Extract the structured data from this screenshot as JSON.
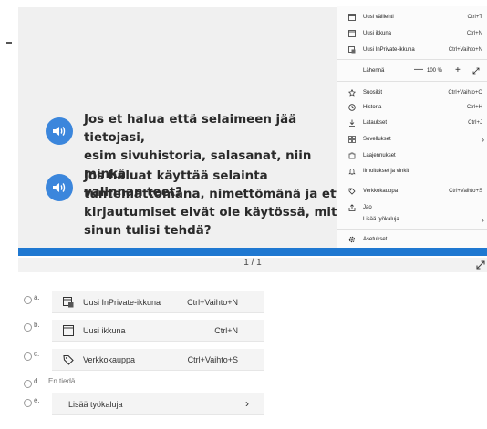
{
  "question": {
    "line1": "Jos et halua että selaimeen jää tietojasi,",
    "line2": "esim sivuhistoria, salasanat, niin minkä",
    "line3": "valinnan teet?",
    "line4": "Jos haluat käyttää selainta",
    "line5": "tuntemattomana, nimettömänä ja että",
    "line6": "kirjautumiset eivät ole käytössä, mitä",
    "line7": "sinun tulisi tehdä?",
    "speaker_icon": "speaker-icon",
    "accent_color": "#3b86dc"
  },
  "pager": {
    "text": "1 / 1"
  },
  "progress": {
    "fraction": 1.0,
    "color": "#1f78d1"
  },
  "menu": {
    "new_tab": {
      "label": "Uusi välilehti",
      "shortcut": "Ctrl+T"
    },
    "new_window": {
      "label": "Uusi ikkuna",
      "shortcut": "Ctrl+N"
    },
    "new_inprivate": {
      "label": "Uusi InPrivate-ikkuna",
      "shortcut": "Ctrl+Vaihto+N"
    },
    "zoom": {
      "label": "Lähennä",
      "minus": "—",
      "value": "100 %",
      "plus": "+"
    },
    "favorites": {
      "label": "Suosikit",
      "shortcut": "Ctrl+Vaihto+O"
    },
    "history": {
      "label": "Historia",
      "shortcut": "Ctrl+H"
    },
    "downloads": {
      "label": "Lataukset",
      "shortcut": "Ctrl+J"
    },
    "apps": {
      "label": "Sovellukset"
    },
    "extensions": {
      "label": "Laajennukset"
    },
    "notifications": {
      "label": "Ilmoitukset ja vinkit"
    },
    "shopping": {
      "label": "Verkkokauppa",
      "shortcut": "Ctrl+Vaihto+S"
    },
    "share": {
      "label": "Jao"
    },
    "more_tools": {
      "label": "Lisää työkaluja"
    },
    "settings": {
      "label": "Asetukset"
    }
  },
  "answers": {
    "a": {
      "letter": "a.",
      "label": "Uusi InPrivate-ikkuna",
      "shortcut": "Ctrl+Vaihto+N"
    },
    "b": {
      "letter": "b.",
      "label": "Uusi ikkuna",
      "shortcut": "Ctrl+N"
    },
    "c": {
      "letter": "c.",
      "label": "Verkkokauppa",
      "shortcut": "Ctrl+Vaihto+S"
    },
    "d": {
      "letter": "d.",
      "label": "En tiedä"
    },
    "e": {
      "letter": "e.",
      "label": "Lisää työkaluja",
      "chevron": "›"
    }
  }
}
